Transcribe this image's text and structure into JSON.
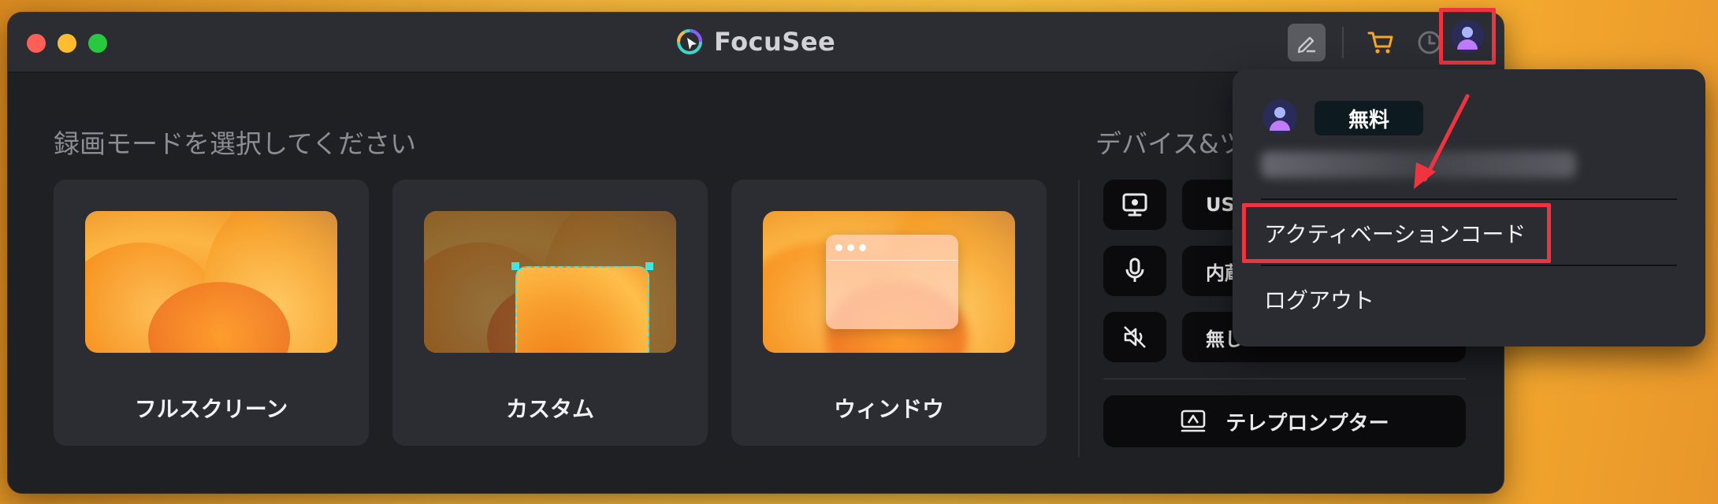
{
  "window": {
    "title": "FocuSee"
  },
  "main": {
    "section_title": "録画モードを選択してください",
    "mode_cards": [
      {
        "label": "フルスクリーン"
      },
      {
        "label": "カスタム"
      },
      {
        "label": "ウィンドウ"
      }
    ]
  },
  "devices": {
    "section_title": "デバイス&ツ",
    "rows": [
      {
        "icon": "monitor-icon",
        "value": "USB"
      },
      {
        "icon": "microphone-icon",
        "value": "内蔵"
      },
      {
        "icon": "speaker-off-icon",
        "value": "無し"
      }
    ],
    "teleprompter_label": "テレプロンプター"
  },
  "account_menu": {
    "plan_badge": "無料",
    "items": [
      {
        "label": "アクティベーションコード"
      },
      {
        "label": "ログアウト"
      }
    ]
  },
  "colors": {
    "highlight": "#f0343f",
    "selection": "#3ee6e6",
    "cart": "#f5a623"
  }
}
